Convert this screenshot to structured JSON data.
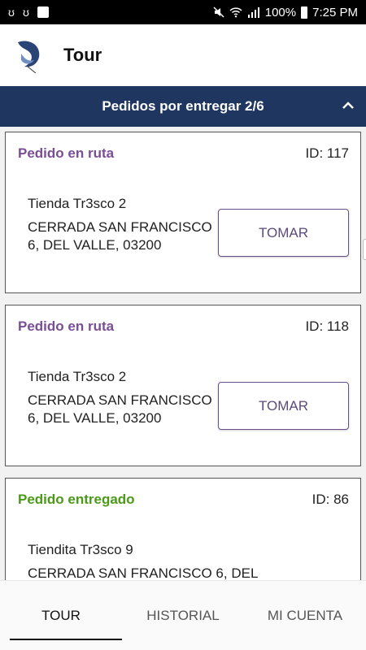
{
  "status_bar": {
    "left_icons": [
      "notification-icon",
      "notification-icon",
      "facebook-icon"
    ],
    "battery": "100%",
    "time": "7:25 PM"
  },
  "header": {
    "title": "Tour"
  },
  "section": {
    "title": "Pedidos por entregar 2/6"
  },
  "orders": [
    {
      "status": "Pedido en ruta",
      "id": "ID: 117",
      "store": "Tienda Tr3sco 2",
      "address": "CERRADA SAN FRANCISCO 6, DEL VALLE, 03200",
      "button": "TOMAR"
    },
    {
      "status": "Pedido en ruta",
      "id": "ID: 118",
      "store": "Tienda Tr3sco 2",
      "address": "CERRADA SAN FRANCISCO 6, DEL VALLE, 03200",
      "button": "TOMAR"
    },
    {
      "status": "Pedido entregado",
      "id": "ID: 86",
      "store": "Tiendita Tr3sco 9",
      "address": "CERRADA SAN FRANCISCO 6, DEL"
    }
  ],
  "tabs": [
    "TOUR",
    "HISTORIAL",
    "MI CUENTA"
  ],
  "colors": {
    "section_bar": "#1f3661",
    "status_route": "#7a4e96",
    "status_delivered": "#4a9a18"
  }
}
